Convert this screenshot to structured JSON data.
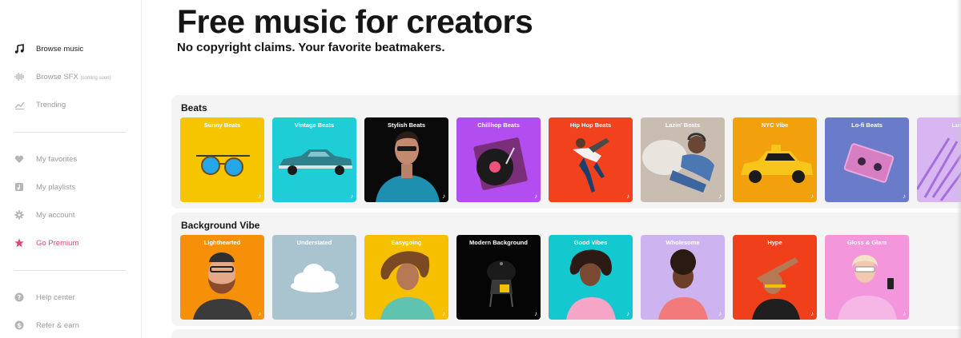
{
  "sidebar": {
    "items": [
      {
        "label": "Browse music",
        "note": "",
        "icon": "music-note-icon",
        "state": "active"
      },
      {
        "label": "Browse SFX",
        "note": "(coming soon)",
        "icon": "waveform-icon",
        "state": "default"
      },
      {
        "label": "Trending",
        "note": "",
        "icon": "trending-icon",
        "state": "default"
      },
      {
        "label": "My favorites",
        "note": "",
        "icon": "heart-icon",
        "state": "default"
      },
      {
        "label": "My playlists",
        "note": "",
        "icon": "playlist-icon",
        "state": "default"
      },
      {
        "label": "My account",
        "note": "",
        "icon": "gear-icon",
        "state": "default"
      },
      {
        "label": "Go Premium",
        "note": "",
        "icon": "star-icon",
        "state": "premium"
      },
      {
        "label": "Help center",
        "note": "",
        "icon": "help-icon",
        "state": "default"
      },
      {
        "label": "Refer & earn",
        "note": "",
        "icon": "dollar-icon",
        "state": "default"
      }
    ]
  },
  "header": {
    "title": "Free music for creators",
    "subtitle": "No copyright claims. Your favorite beatmakers."
  },
  "sections": [
    {
      "title": "Beats",
      "cards": [
        {
          "title": "Sunny Beats",
          "color": "#f7c400",
          "art": "sunglasses"
        },
        {
          "title": "Vintage Beats",
          "color": "#1ecdd6",
          "art": "vintage-car"
        },
        {
          "title": "Stylish Beats",
          "color": "#0a0a0a",
          "art": "man-portrait"
        },
        {
          "title": "Chillhop Beats",
          "color": "#b24df0",
          "art": "turntable"
        },
        {
          "title": "Hip Hop Beats",
          "color": "#f2411d",
          "art": "breakdancer"
        },
        {
          "title": "Lazin' Beats",
          "color": "#c9bcb1",
          "art": "woman-headphones"
        },
        {
          "title": "NYC Vibe",
          "color": "#f2a00c",
          "art": "taxi"
        },
        {
          "title": "Lo-fi Beats",
          "color": "#6a7cc9",
          "art": "cassette"
        },
        {
          "title": "Lush",
          "color": "#d8b6f2",
          "art": "palm-leaf"
        }
      ]
    },
    {
      "title": "Background Vibe",
      "cards": [
        {
          "title": "Lighthearted",
          "color": "#f59008",
          "art": "bearded-man"
        },
        {
          "title": "Understated",
          "color": "#a9c4cf",
          "art": "cloud"
        },
        {
          "title": "Easygoing",
          "color": "#f6c000",
          "art": "woman-hair"
        },
        {
          "title": "Modern Background",
          "color": "#050505",
          "art": "chair"
        },
        {
          "title": "Good Vibes",
          "color": "#13c8cf",
          "art": "woman-curly"
        },
        {
          "title": "Wholesome",
          "color": "#cdb4f0",
          "art": "woman-afro"
        },
        {
          "title": "Hype",
          "color": "#ef3f1b",
          "art": "man-dab"
        },
        {
          "title": "Gloss & Glam",
          "color": "#f396dc",
          "art": "woman-phone"
        }
      ]
    }
  ],
  "card_badge": "♪"
}
